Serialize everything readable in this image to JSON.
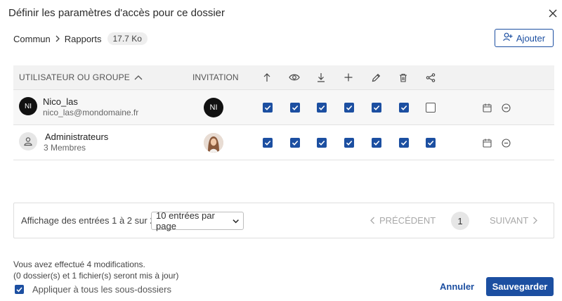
{
  "dialog": {
    "title": "Définir les paramètres d'accès pour ce dossier"
  },
  "breadcrumb": {
    "items": [
      "Commun",
      "Rapports"
    ],
    "size": "17.7 Ko"
  },
  "add_button": {
    "label": "Ajouter"
  },
  "table": {
    "headers": {
      "user": "UTILISATEUR OU GROUPE",
      "invitation": "INVITATION"
    },
    "permission_icons": [
      "upload-icon",
      "eye-icon",
      "download-icon",
      "plus-icon",
      "pencil-icon",
      "trash-icon",
      "share-icon"
    ],
    "rows": [
      {
        "name": "Nico_las",
        "sub": "nico_las@mondomaine.fr",
        "initials": "NI",
        "invitation_initials": "NI",
        "permissions": [
          true,
          true,
          true,
          true,
          true,
          true,
          false
        ]
      },
      {
        "name": "Administrateurs",
        "sub": "3 Membres",
        "initials": "",
        "invitation_initials": "",
        "permissions": [
          true,
          true,
          true,
          true,
          true,
          true,
          true
        ]
      }
    ]
  },
  "pagination": {
    "summary": "Affichage des entrées 1 à 2 sur 2",
    "per_page": "10 entrées par page",
    "prev": "PRÉCÉDENT",
    "page": "1",
    "next": "SUIVANT"
  },
  "footer": {
    "message1": "Vous avez effectué 4 modifications.",
    "message2": "(0 dossier(s) et 1 fichier(s) seront mis à jour)",
    "apply_all_label": "Appliquer à tous les sous-dossiers",
    "apply_all_checked": true,
    "cancel": "Annuler",
    "save": "Sauvegarder"
  },
  "colors": {
    "primary": "#1c4fa1",
    "header_bg": "#f2f2f2"
  }
}
